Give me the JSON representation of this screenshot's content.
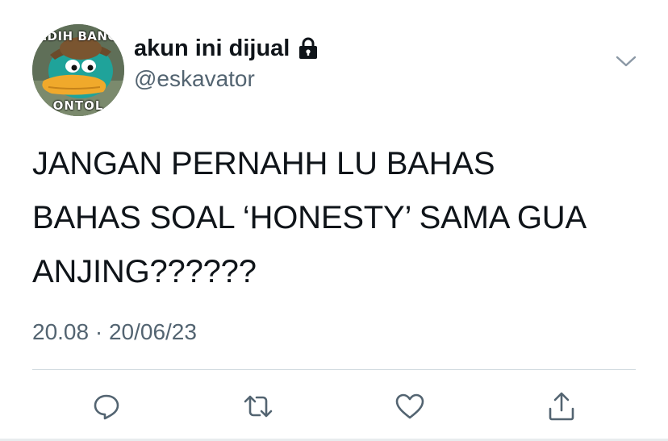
{
  "user": {
    "display_name": "akun ini dijual",
    "handle": "@eskavator",
    "avatar": {
      "caption_top": "ƎDIH BANG",
      "caption_bottom": "ONTOL"
    },
    "verified_icon": "lock-icon"
  },
  "tweet": {
    "text": "JANGAN PERNAHH LU BAHAS\nBAHAS SOAL ‘HONESTY’ SAMA GUA\nANJING??????",
    "timestamp": "20.08 · 20/06/23"
  },
  "menu": {
    "icon": "chevron-down-icon"
  },
  "actions": [
    {
      "name": "reply",
      "icon": "speech-bubble-icon"
    },
    {
      "name": "retweet",
      "icon": "retweet-icon"
    },
    {
      "name": "like",
      "icon": "heart-icon"
    },
    {
      "name": "share",
      "icon": "share-icon"
    }
  ],
  "colors": {
    "text": "#0f1419",
    "secondary": "#536471",
    "divider": "#cfd9de",
    "icon": "#536471"
  }
}
